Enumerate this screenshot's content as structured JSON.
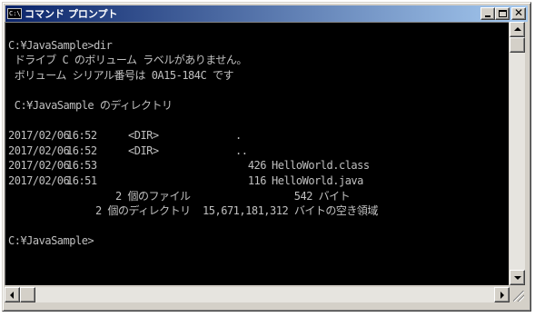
{
  "window": {
    "title": "コマンド プロンプト",
    "icon_text": "C:\\",
    "icon": "console-icon"
  },
  "console": {
    "prompt_line": "C:¥JavaSample>dir",
    "volume_label_line": " ドライブ C のボリューム ラベルがありません。",
    "serial_line": " ボリューム シリアル番号は 0A15-184C です",
    "directory_line": " C:¥JavaSample のディレクトリ",
    "entries": [
      {
        "date": "2017/02/06",
        "time": "16:52",
        "dir": "<DIR>",
        "size": "",
        "name": "."
      },
      {
        "date": "2017/02/06",
        "time": "16:52",
        "dir": "<DIR>",
        "size": "",
        "name": ".."
      },
      {
        "date": "2017/02/06",
        "time": "16:53",
        "dir": "",
        "size": "426",
        "name": "HelloWorld.class"
      },
      {
        "date": "2017/02/06",
        "time": "16:51",
        "dir": "",
        "size": "116",
        "name": "HelloWorld.java"
      }
    ],
    "summary_files": "2 個のファイル                 542 バイト",
    "summary_dirs": "2 個のディレクトリ  15,671,181,312 バイトの空き領域",
    "final_prompt": "C:¥JavaSample>"
  },
  "colors": {
    "console_bg": "#000000",
    "console_text": "#c0c0c0",
    "titlebar_start": "#0a246a",
    "titlebar_end": "#a6caf0"
  }
}
